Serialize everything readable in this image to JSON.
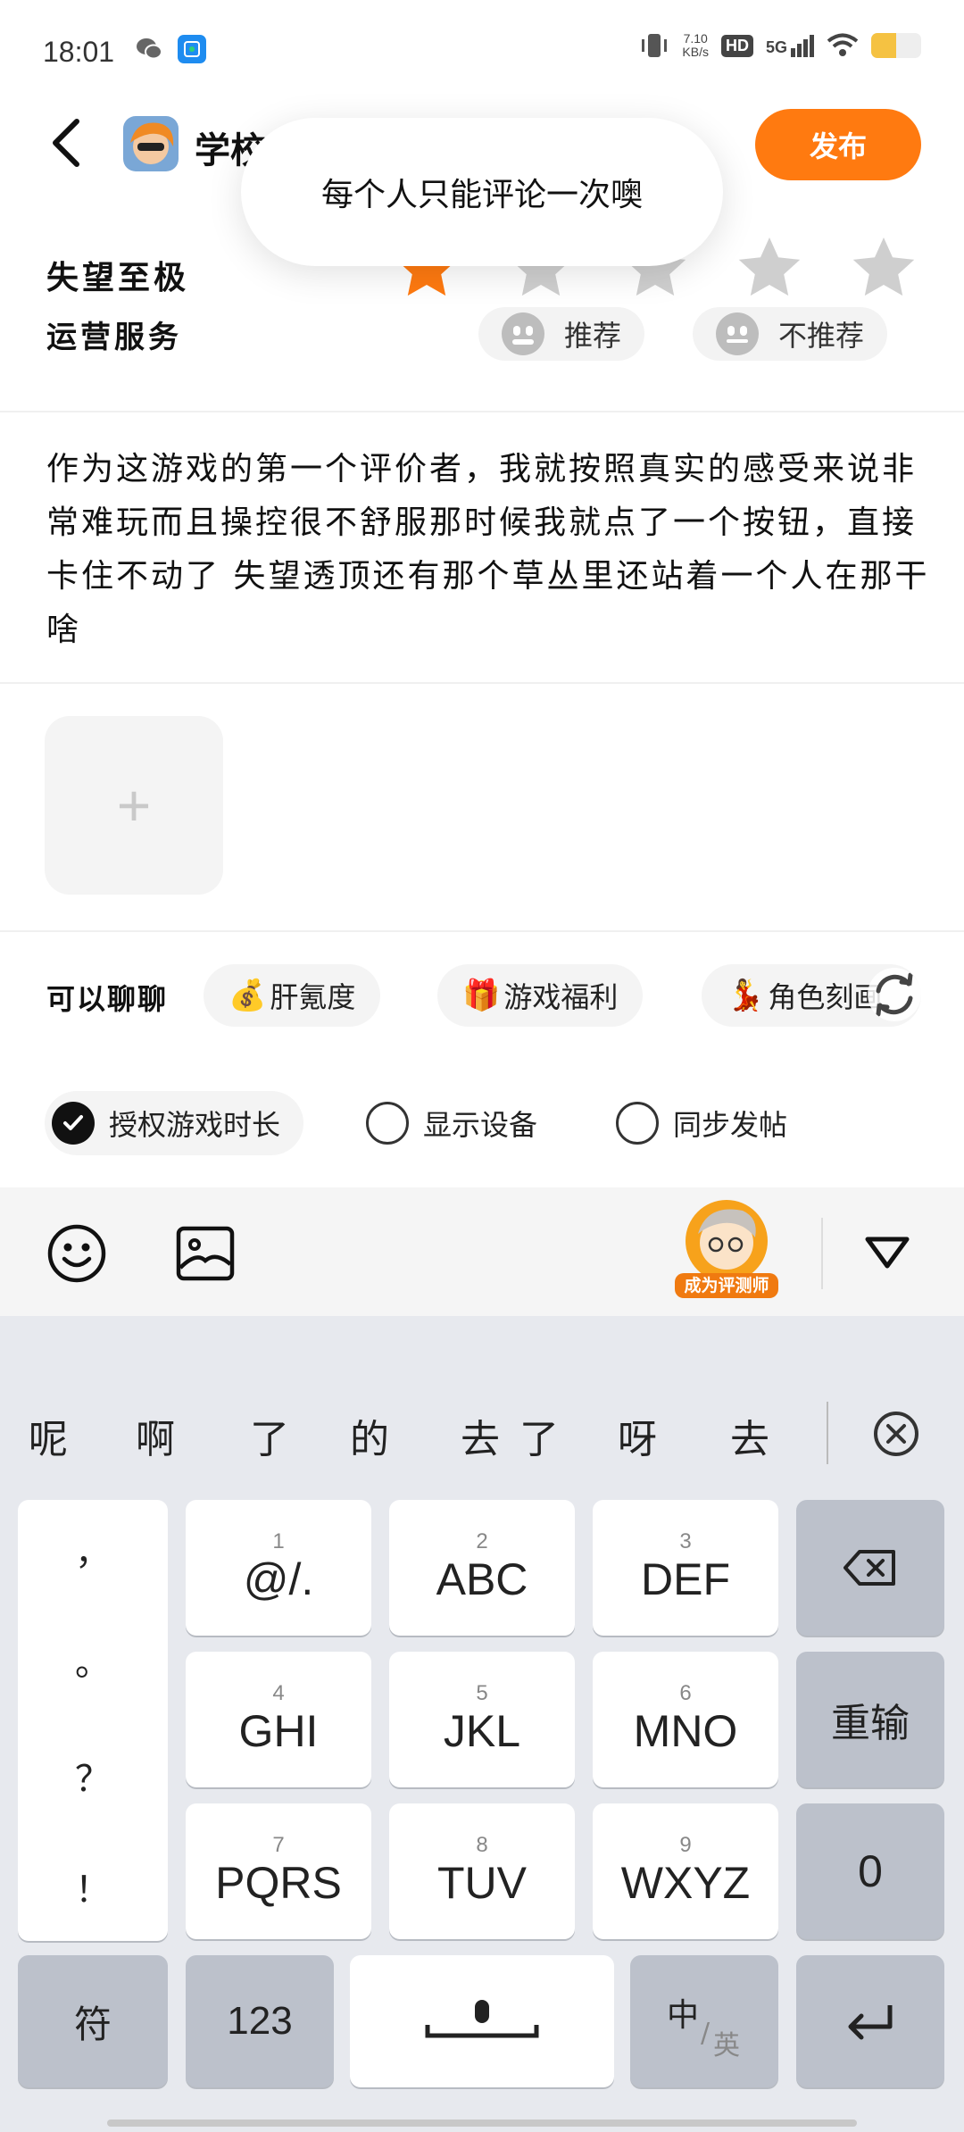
{
  "status_bar": {
    "time": "18:01",
    "net_speed_value": "7.10",
    "net_speed_unit": "KB/s",
    "hd": "HD",
    "signal": "5G",
    "battery_level": 0.5,
    "left_icons": [
      "wechat-icon",
      "app-notification-icon"
    ]
  },
  "header": {
    "title": "学校",
    "publish_label": "发布",
    "accent": "#ff7a10"
  },
  "toast": {
    "message": "每个人只能评论一次噢"
  },
  "rating": {
    "label": "失望至极",
    "value": 1,
    "max": 5,
    "active_color": "#ff7a10",
    "inactive_color": "#cfcfcf"
  },
  "ops_service": {
    "label": "运营服务",
    "recommend": "推荐",
    "not_recommend": "不推荐"
  },
  "review": {
    "text": "作为这游戏的第一个评价者，我就按照真实的感受来说非常难玩而且操控很不舒服那时候我就点了一个按钮，直接卡住不动了 失望透顶还有那个草丛里还站着一个人在那干啥"
  },
  "add_image": {
    "icon": "+"
  },
  "topics": {
    "label": "可以聊聊",
    "chips": [
      {
        "emoji": "💰",
        "label": "肝氪度"
      },
      {
        "emoji": "🎁",
        "label": "游戏福利"
      },
      {
        "emoji": "💃",
        "label": "角色刻画"
      }
    ]
  },
  "options": [
    {
      "label": "授权游戏时长",
      "checked": true
    },
    {
      "label": "显示设备",
      "checked": false
    },
    {
      "label": "同步发帖",
      "checked": false
    }
  ],
  "toolbar": {
    "badge_text": "成为评测师"
  },
  "keyboard": {
    "candidates": [
      "呢",
      "啊",
      "了",
      "的",
      "去了",
      "呀",
      "去"
    ],
    "punctuation": [
      "，",
      "。",
      "？",
      "！"
    ],
    "keys": [
      {
        "num": "1",
        "label": "@/."
      },
      {
        "num": "2",
        "label": "ABC"
      },
      {
        "num": "3",
        "label": "DEF"
      },
      {
        "num": "4",
        "label": "GHI"
      },
      {
        "num": "5",
        "label": "JKL"
      },
      {
        "num": "6",
        "label": "MNO"
      },
      {
        "num": "7",
        "label": "PQRS"
      },
      {
        "num": "8",
        "label": "TUV"
      },
      {
        "num": "9",
        "label": "WXYZ"
      }
    ],
    "reset": "重输",
    "zero": "0",
    "symbols": "符",
    "numbers": "123",
    "lang_main": "中",
    "lang_alt": "英"
  }
}
